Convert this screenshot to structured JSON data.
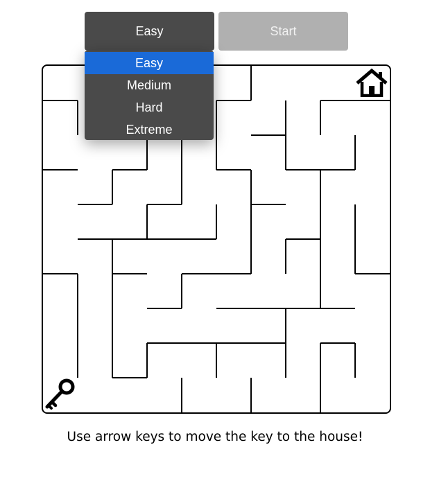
{
  "controls": {
    "difficulty_selected": "Easy",
    "start_label": "Start"
  },
  "dropdown": {
    "options": [
      "Easy",
      "Medium",
      "Hard",
      "Extreme"
    ],
    "highlighted": "Easy"
  },
  "maze": {
    "goal_icon": "house-icon",
    "player_icon": "key-icon"
  },
  "instructions": "Use arrow keys to move the key to the house!",
  "colors": {
    "button_dark": "#4a4a4a",
    "button_disabled": "#b0b0b0",
    "highlight": "#1a6ad8",
    "walls": "#000000"
  }
}
